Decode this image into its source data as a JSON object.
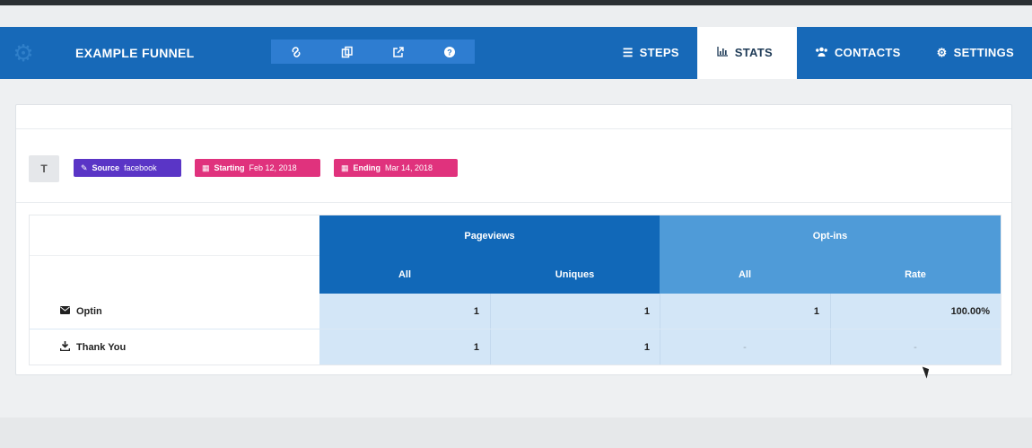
{
  "header": {
    "funnel_name": "EXAMPLE FUNNEL",
    "logo_icon": "gear-logo-icon",
    "icon_buttons": [
      {
        "icon": "link-icon",
        "glyph": "🔗"
      },
      {
        "icon": "copy-icon",
        "glyph": "⧉"
      },
      {
        "icon": "external-link-icon",
        "glyph": "↗"
      },
      {
        "icon": "help-icon",
        "glyph": "?"
      }
    ],
    "tabs": [
      {
        "label": "STEPS",
        "icon": "list-icon",
        "glyph": "☰",
        "active": false
      },
      {
        "label": "STATS",
        "icon": "chart-icon",
        "glyph": "📊",
        "active": true
      },
      {
        "label": "CONTACTS",
        "icon": "users-icon",
        "glyph": "👥",
        "active": false
      },
      {
        "label": "SETTINGS",
        "icon": "gear-icon",
        "glyph": "⚙",
        "active": false
      }
    ]
  },
  "filters": {
    "filter_button_label": "T",
    "source": {
      "key": "Source",
      "value": "facebook"
    },
    "starting": {
      "key": "Starting",
      "value": "Feb 12, 2018"
    },
    "ending": {
      "key": "Ending",
      "value": "Mar 14, 2018"
    }
  },
  "table": {
    "groups": [
      "Pageviews",
      "Opt-ins"
    ],
    "subheaders": [
      "All",
      "Uniques",
      "All",
      "Rate"
    ],
    "rows": [
      {
        "icon": "envelope-icon",
        "glyph": "✉",
        "label": "Optin",
        "values": [
          "1",
          "1",
          "1",
          "100.00%"
        ]
      },
      {
        "icon": "download-icon",
        "glyph": "⤓",
        "label": "Thank You",
        "values": [
          "1",
          "1",
          "-",
          "-"
        ]
      }
    ]
  },
  "colors": {
    "navbar": "#1769b8",
    "pageviews_header": "#1168b8",
    "optins_header": "#4f9bd8",
    "source_chip": "#5a35c6",
    "date_chip": "#e0327d"
  }
}
